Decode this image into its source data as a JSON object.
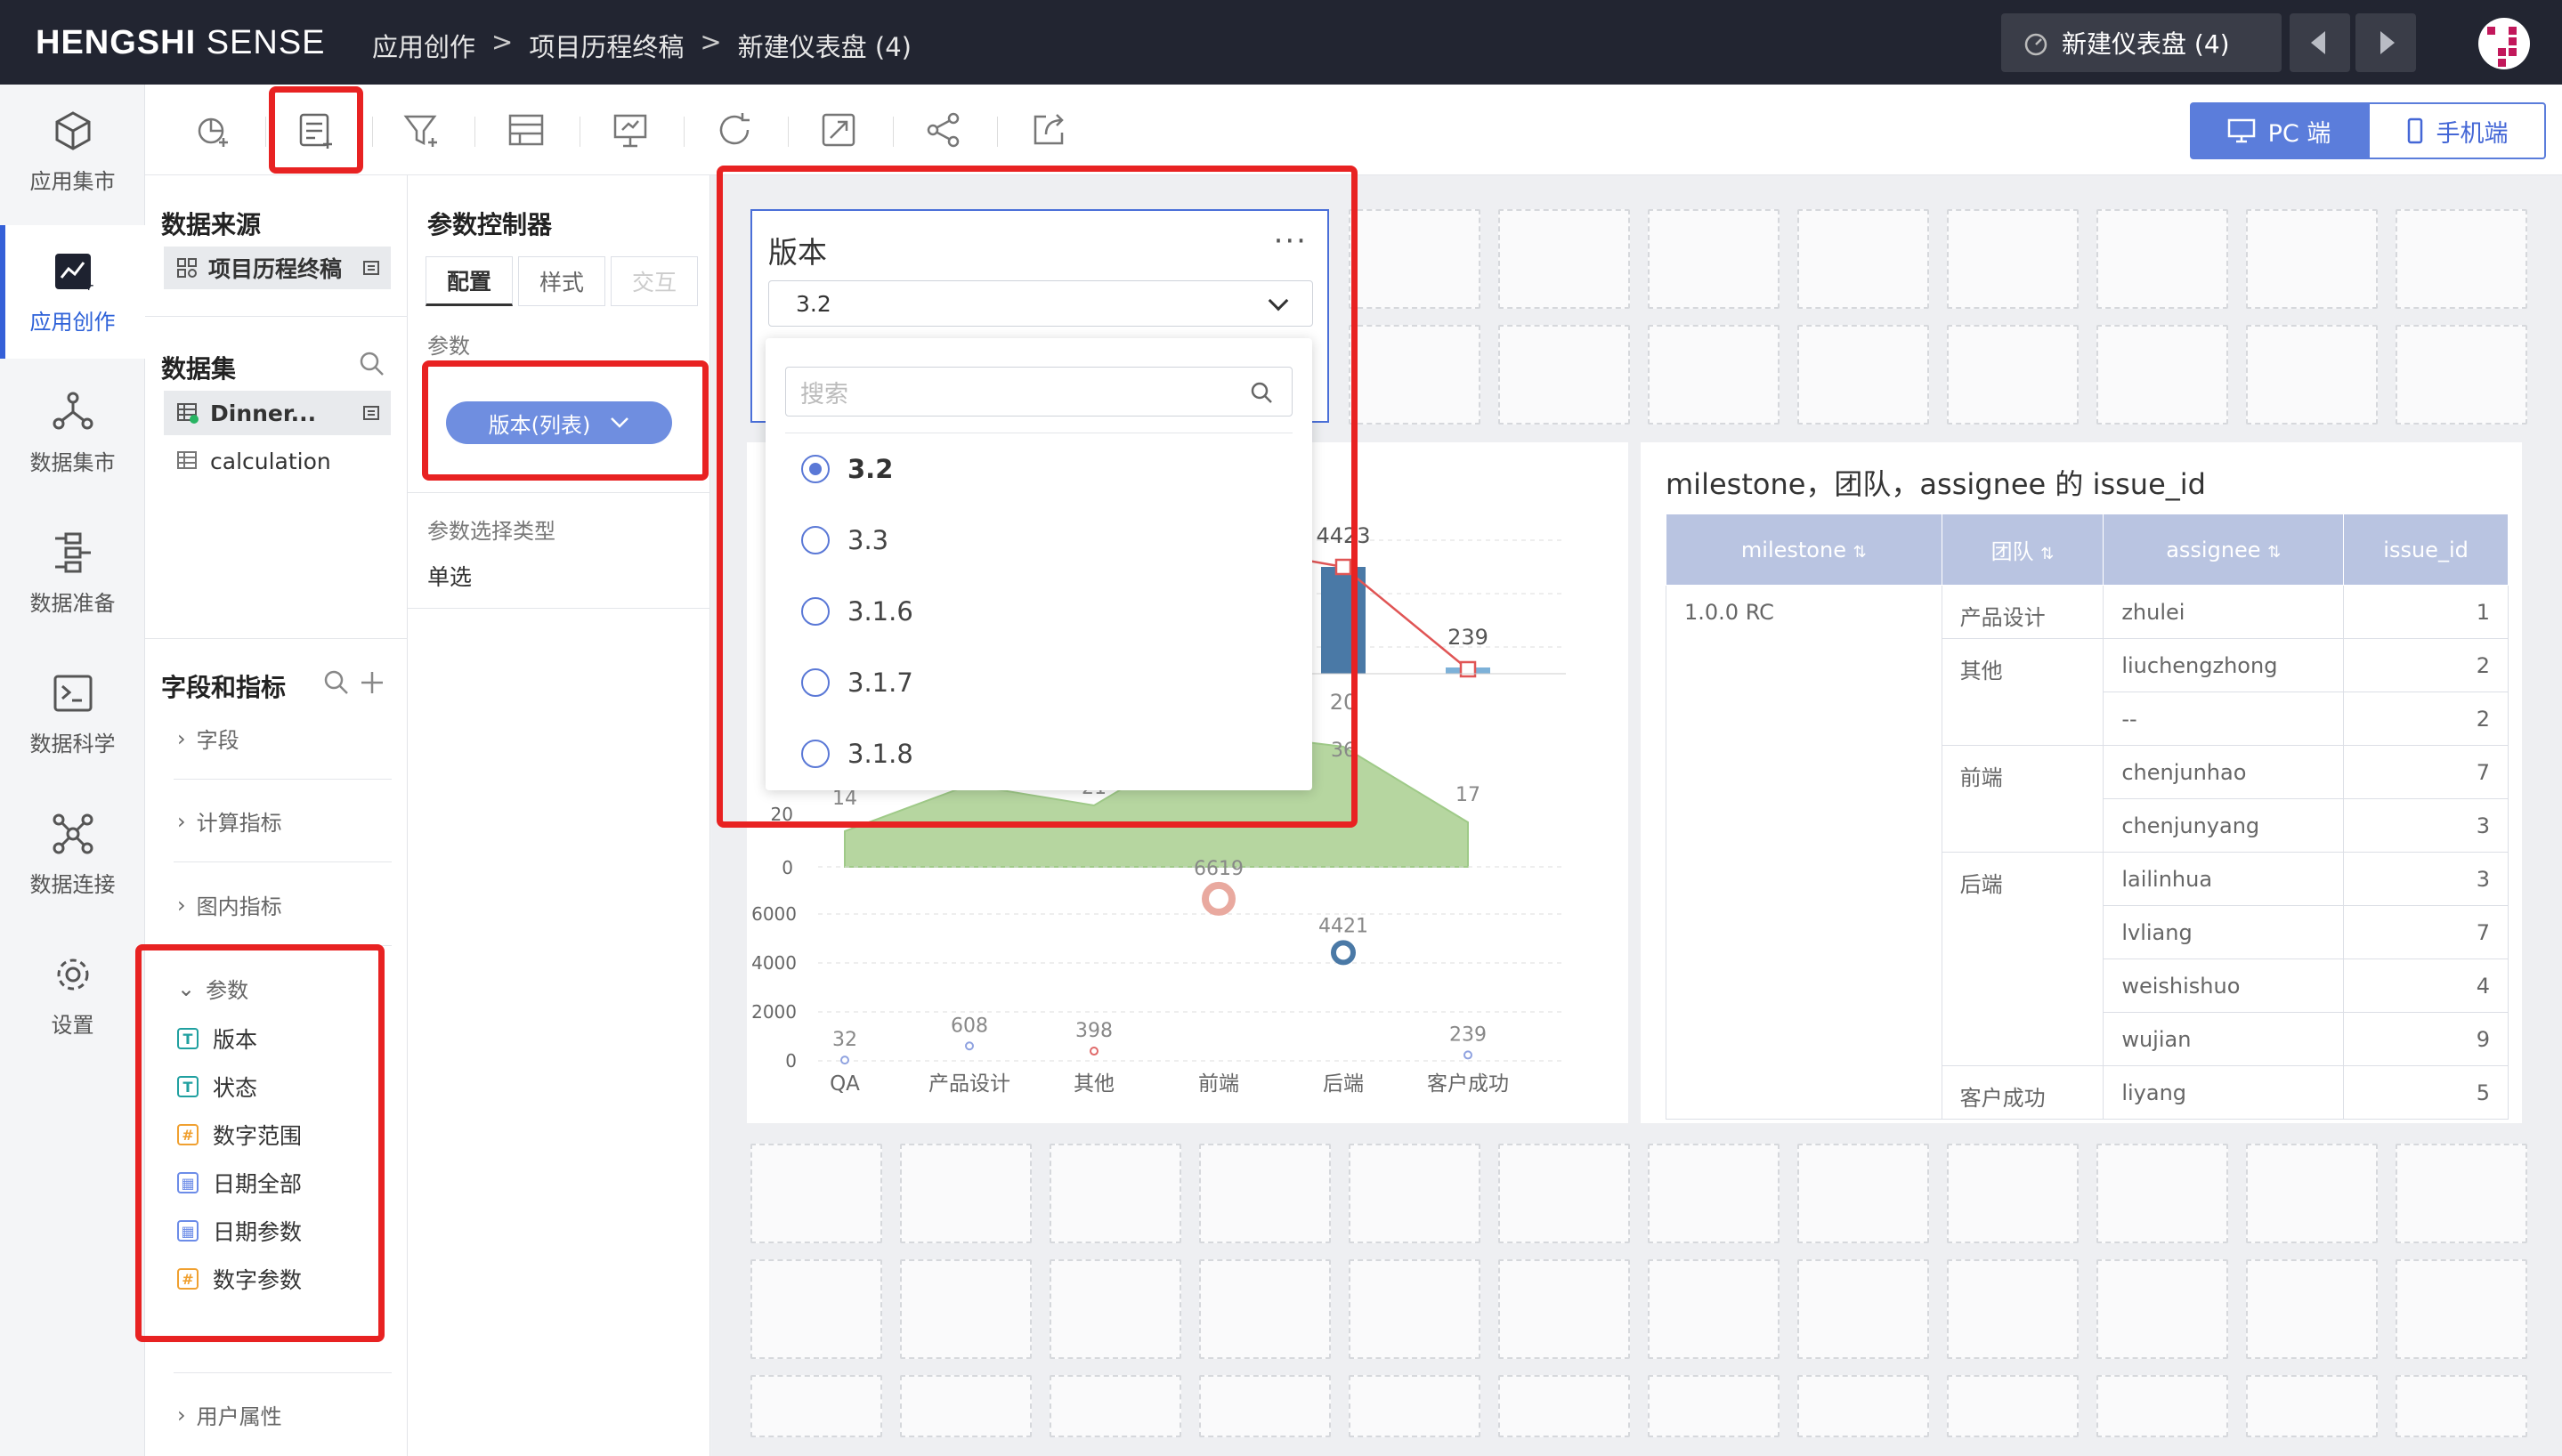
{
  "app": {
    "logo_bold": "HENGSHI",
    "logo_light": " SENSE",
    "breadcrumb": [
      "应用创作",
      "项目历程终稿",
      "新建仪表盘 (4)"
    ],
    "breadcrumb_sep": ">",
    "dashboard_button": "新建仪表盘 (4)"
  },
  "nav": [
    {
      "label": "应用集市",
      "icon": "cube-icon"
    },
    {
      "label": "应用创作",
      "icon": "chart-edit-icon",
      "active": true
    },
    {
      "label": "数据集市",
      "icon": "network-icon"
    },
    {
      "label": "数据准备",
      "icon": "flow-icon"
    },
    {
      "label": "数据科学",
      "icon": "terminal-icon"
    },
    {
      "label": "数据连接",
      "icon": "connect-icon"
    },
    {
      "label": "设置",
      "icon": "gear-icon"
    }
  ],
  "toolbar": {
    "device_pc": "PC 端",
    "device_mobile": "手机端"
  },
  "datapanel": {
    "source_title": "数据来源",
    "source_item": "项目历程终稿",
    "dataset_title": "数据集",
    "datasets": [
      "Dinner...",
      "calculation"
    ],
    "fields_title": "字段和指标",
    "folds": [
      "字段",
      "计算指标",
      "图内指标"
    ],
    "params_fold": "参数",
    "params": [
      {
        "name": "版本",
        "type": "T"
      },
      {
        "name": "状态",
        "type": "T"
      },
      {
        "name": "数字范围",
        "type": "#"
      },
      {
        "name": "日期全部",
        "type": "D"
      },
      {
        "name": "日期参数",
        "type": "D"
      },
      {
        "name": "数字参数",
        "type": "#"
      }
    ],
    "user_attr": "用户属性"
  },
  "ctlpanel": {
    "title": "参数控制器",
    "tabs": [
      "配置",
      "样式",
      "交互"
    ],
    "param_label": "参数",
    "param_pill": "版本(列表)",
    "select_type_label": "参数选择类型",
    "select_type_value": "单选"
  },
  "version_widget": {
    "title": "版本",
    "more": "···",
    "selected": "3.2",
    "search_placeholder": "搜索",
    "options": [
      "3.2",
      "3.3",
      "3.1.6",
      "3.1.7",
      "3.1.8"
    ],
    "checked_index": 0
  },
  "chart_data": {
    "type": "bar",
    "categories": [
      "QA",
      "产品设计",
      "其他",
      "前端",
      "后端",
      "客户成功"
    ],
    "top_panel": {
      "visible_bar_labels": [
        {
          "category": "后端",
          "value": 4423
        },
        {
          "category": "客户成功",
          "value": 239
        }
      ],
      "visible_axis_label": "20"
    },
    "area_series": {
      "labels": [
        14,
        21,
        36,
        17
      ],
      "visible_ticks": [
        "20",
        "0"
      ]
    },
    "scatter_series": {
      "values": [
        32,
        608,
        398,
        6619,
        4421,
        239
      ],
      "yticks": [
        "6000",
        "4000",
        "2000",
        "0"
      ]
    },
    "colors": {
      "bar": "#4a79a6",
      "line": "#e05555",
      "area": "#b6d6a0",
      "scatter_high": "#e9a99f",
      "scatter_mid": "#4a79a6"
    }
  },
  "table": {
    "title": "milestone，团队，assignee 的 issue_id",
    "headers": [
      "milestone",
      "团队",
      "assignee",
      "issue_id"
    ],
    "milestone": "1.0.0 RC",
    "rows": [
      {
        "team": "产品设计",
        "assignee": "zhulei",
        "id": "1"
      },
      {
        "team": "其他",
        "assignee": "liuchengzhong",
        "id": "2"
      },
      {
        "team": "",
        "assignee": "--",
        "id": "2"
      },
      {
        "team": "前端",
        "assignee": "chenjunhao",
        "id": "7"
      },
      {
        "team": "",
        "assignee": "chenjunyang",
        "id": "3"
      },
      {
        "team": "后端",
        "assignee": "lailinhua",
        "id": "3"
      },
      {
        "team": "",
        "assignee": "lvliang",
        "id": "7"
      },
      {
        "team": "",
        "assignee": "weishishuo",
        "id": "4"
      },
      {
        "team": "",
        "assignee": "wujian",
        "id": "9"
      },
      {
        "team": "客户成功",
        "assignee": "liyang",
        "id": "5"
      }
    ]
  }
}
